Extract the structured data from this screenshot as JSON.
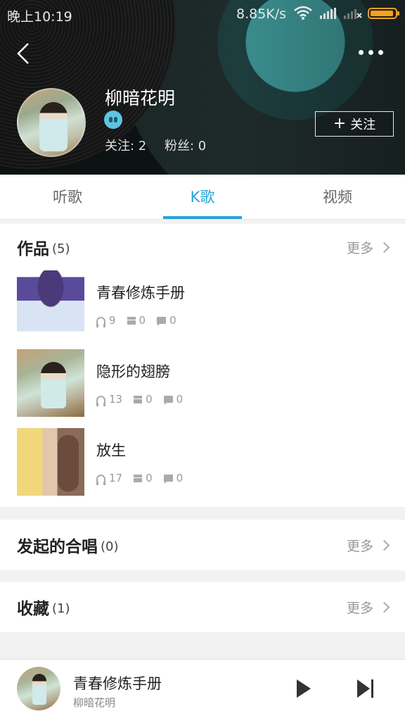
{
  "status_bar": {
    "time": "晚上10:19",
    "net_speed": "8.85K/s"
  },
  "profile": {
    "name": "柳暗花明",
    "following": "关注: 2",
    "followers": "粉丝: 0",
    "follow_button": "关注",
    "icons": {
      "back": "back-arrow-icon",
      "more": "more-dots-icon",
      "badge": "badge-icon",
      "plus": "plus-icon"
    }
  },
  "tabs": [
    {
      "label": "听歌",
      "active": false
    },
    {
      "label": "K歌",
      "active": true
    },
    {
      "label": "视频",
      "active": false
    }
  ],
  "works": {
    "title": "作品",
    "count": "(5)",
    "more": "更多",
    "items": [
      {
        "title": "青春修炼手册",
        "listens": "9",
        "gifts": "0",
        "comments": "0"
      },
      {
        "title": "隐形的翅膀",
        "listens": "13",
        "gifts": "0",
        "comments": "0"
      },
      {
        "title": "放生",
        "listens": "17",
        "gifts": "0",
        "comments": "0"
      }
    ]
  },
  "chorus": {
    "title": "发起的合唱",
    "count": "(0)",
    "more": "更多"
  },
  "favorites": {
    "title": "收藏",
    "count": "(1)",
    "more": "更多"
  },
  "player": {
    "title": "青春修炼手册",
    "artist": "柳暗花明"
  },
  "colors": {
    "accent": "#27a2d9",
    "battery": "#f5a020"
  }
}
